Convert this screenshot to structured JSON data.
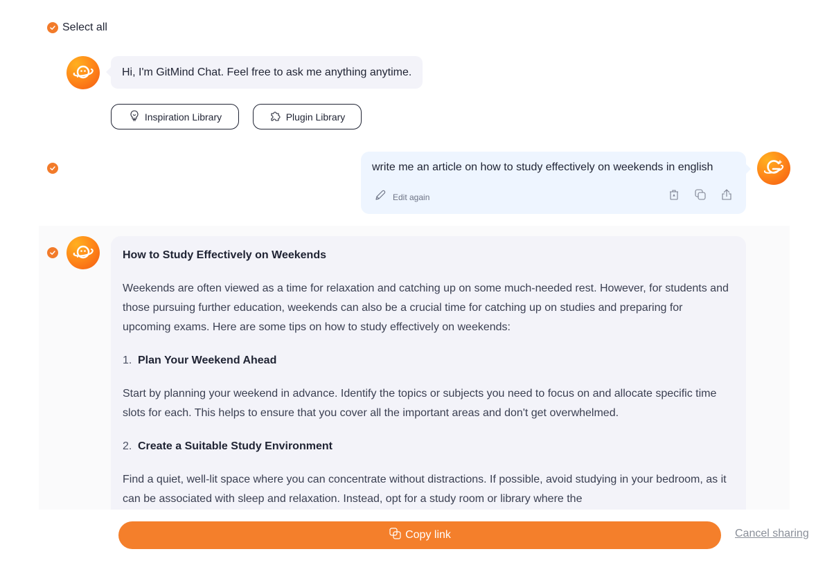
{
  "select_all": {
    "label": "Select all",
    "checked": true
  },
  "greeting": {
    "text": "Hi, I'm GitMind Chat. Feel free to ask me anything anytime.",
    "buttons": [
      {
        "label": "Inspiration Library",
        "icon": "lightbulb-icon"
      },
      {
        "label": "Plugin Library",
        "icon": "puzzle-icon"
      }
    ]
  },
  "user_message": {
    "checked": true,
    "text": "write me an article on how to study effectively on weekends in english",
    "edit_label": "Edit again",
    "actions": [
      "delete-icon",
      "copy-icon",
      "share-icon"
    ]
  },
  "answer": {
    "checked": true,
    "title": "How to Study Effectively on Weekends",
    "intro": "Weekends are often viewed as a time for relaxation and catching up on some much-needed rest. However, for students and those pursuing further education, weekends can also be a crucial time for catching up on studies and preparing for upcoming exams. Here are some tips on how to study effectively on weekends:",
    "sections": [
      {
        "number": "1.",
        "heading": "Plan Your Weekend Ahead",
        "body": "Start by planning your weekend in advance. Identify the topics or subjects you need to focus on and allocate specific time slots for each. This helps to ensure that you cover all the important areas and don't get overwhelmed."
      },
      {
        "number": "2.",
        "heading": "Create a Suitable Study Environment",
        "body": "Find a quiet, well-lit space where you can concentrate without distractions. If possible, avoid studying in your bedroom, as it can be associated with sleep and relaxation. Instead, opt for a study room or library where the"
      }
    ]
  },
  "footer": {
    "copy_link_label": "Copy link",
    "cancel_label": "Cancel sharing"
  },
  "colors": {
    "accent": "#f47f2b",
    "bot_bubble": "#f3f3f9",
    "user_bubble": "#eef5ff"
  }
}
